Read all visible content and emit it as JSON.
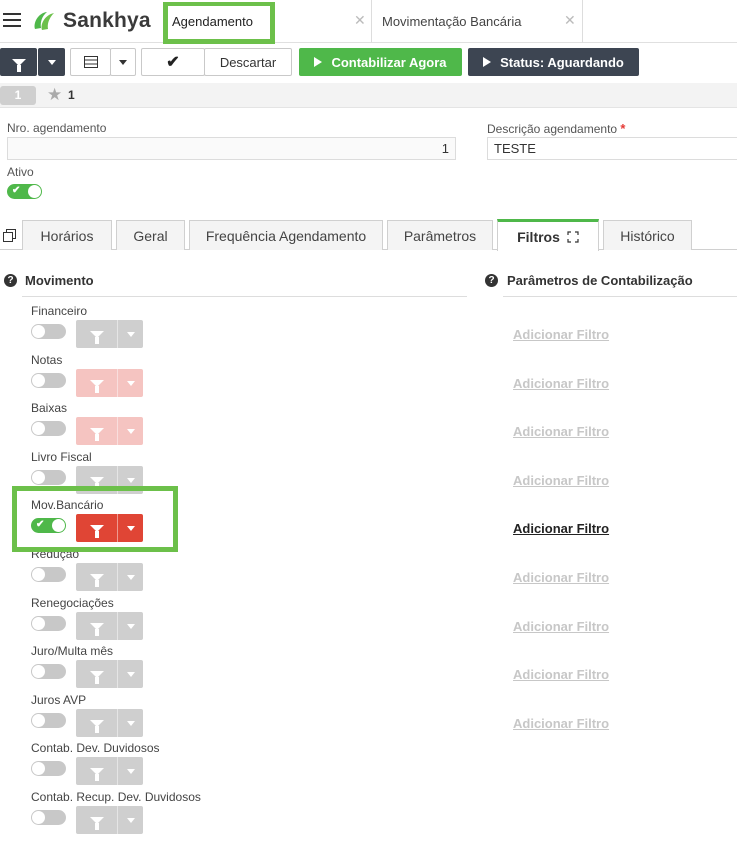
{
  "brand": {
    "name": "Sankhya",
    "color": "#4fb84a"
  },
  "tabs": [
    {
      "label": "Agendamento",
      "active": true
    },
    {
      "label": "Movimentação Bancária",
      "active": false
    }
  ],
  "toolbar": {
    "filter_icon": "funnel-icon",
    "grid_icon": "grid-icon",
    "confirm_icon": "check-icon",
    "discard_label": "Descartar",
    "run_label": "Contabilizar Agora",
    "status_label": "Status: Aguardando"
  },
  "record_nav": {
    "current": "1",
    "count": "1"
  },
  "form": {
    "nro_label": "Nro. agendamento",
    "nro_value": "1",
    "desc_label": "Descrição agendamento",
    "desc_required": "*",
    "desc_value": "TESTE",
    "ativo_label": "Ativo",
    "ativo_on": true
  },
  "form_tabs": [
    {
      "label": "Horários"
    },
    {
      "label": "Geral"
    },
    {
      "label": "Frequência Agendamento"
    },
    {
      "label": "Parâmetros"
    },
    {
      "label": "Filtros",
      "active": true
    },
    {
      "label": "Histórico"
    }
  ],
  "movimento": {
    "title": "Movimento",
    "items": [
      {
        "label": "Financeiro",
        "on": false,
        "style": "gray"
      },
      {
        "label": "Notas",
        "on": false,
        "style": "pink"
      },
      {
        "label": "Baixas",
        "on": false,
        "style": "pink"
      },
      {
        "label": "Livro Fiscal",
        "on": false,
        "style": "gray"
      },
      {
        "label": "Mov.Bancário",
        "on": true,
        "style": "red"
      },
      {
        "label": "Redução",
        "on": false,
        "style": "gray"
      },
      {
        "label": "Renegociações",
        "on": false,
        "style": "gray"
      },
      {
        "label": "Juro/Multa mês",
        "on": false,
        "style": "gray"
      },
      {
        "label": "Juros AVP",
        "on": false,
        "style": "gray"
      },
      {
        "label": "Contab. Dev. Duvidosos",
        "on": false,
        "style": "gray"
      },
      {
        "label": "Contab. Recup. Dev. Duvidosos",
        "on": false,
        "style": "gray"
      }
    ]
  },
  "parametros": {
    "title": "Parâmetros de Contabilização",
    "add_filter_label": "Adicionar Filtro",
    "links": [
      {
        "active": false
      },
      {
        "active": false
      },
      {
        "active": false
      },
      {
        "active": false
      },
      {
        "active": true
      },
      {
        "active": false
      },
      {
        "active": false
      },
      {
        "active": false
      },
      {
        "active": false
      }
    ]
  }
}
